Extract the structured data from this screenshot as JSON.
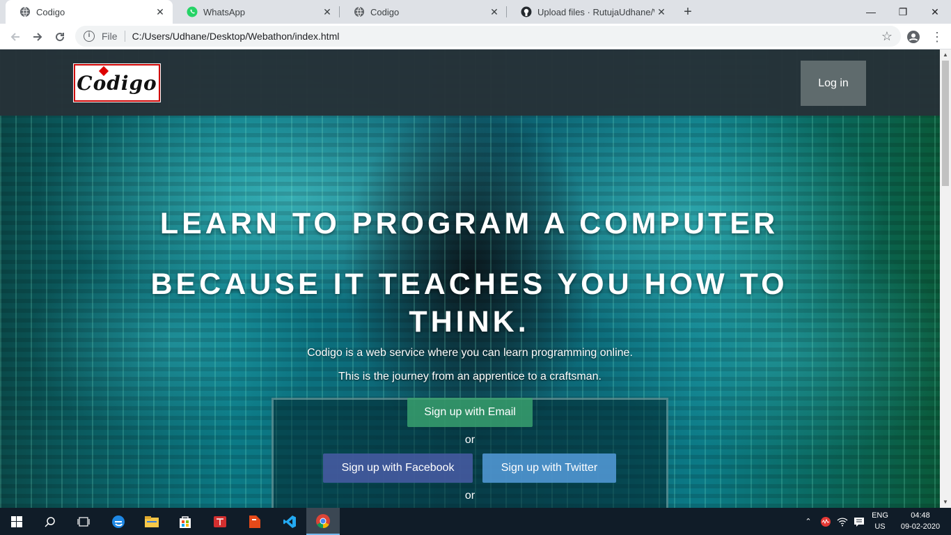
{
  "browser": {
    "tabs": [
      {
        "title": "Codigo",
        "favicon": "globe-icon",
        "active": true
      },
      {
        "title": "WhatsApp",
        "favicon": "whatsapp-icon",
        "active": false
      },
      {
        "title": "Codigo",
        "favicon": "globe-icon",
        "active": false
      },
      {
        "title": "Upload files · RutujaUdhane/Web",
        "favicon": "github-icon",
        "active": false
      }
    ],
    "scheme_label": "File",
    "url": "C:/Users/Udhane/Desktop/Webathon/index.html"
  },
  "page": {
    "logo_text": "Codigo",
    "login_label": "Log in",
    "headline_1": "LEARN TO PROGRAM A COMPUTER",
    "headline_2": "BECAUSE IT TEACHES YOU HOW TO THINK.",
    "subtitle_1": "Codigo is a web service where you can learn programming online.",
    "subtitle_2": "This is the journey from an apprentice to a craftsman.",
    "signup_email": "Sign up with Email",
    "or_1": "or",
    "signup_facebook": "Sign up with Facebook",
    "signup_twitter": "Sign up with Twitter",
    "or_2": "or"
  },
  "taskbar": {
    "lang_1": "ENG",
    "lang_2": "US",
    "time": "04:48",
    "date": "09-02-2020"
  }
}
